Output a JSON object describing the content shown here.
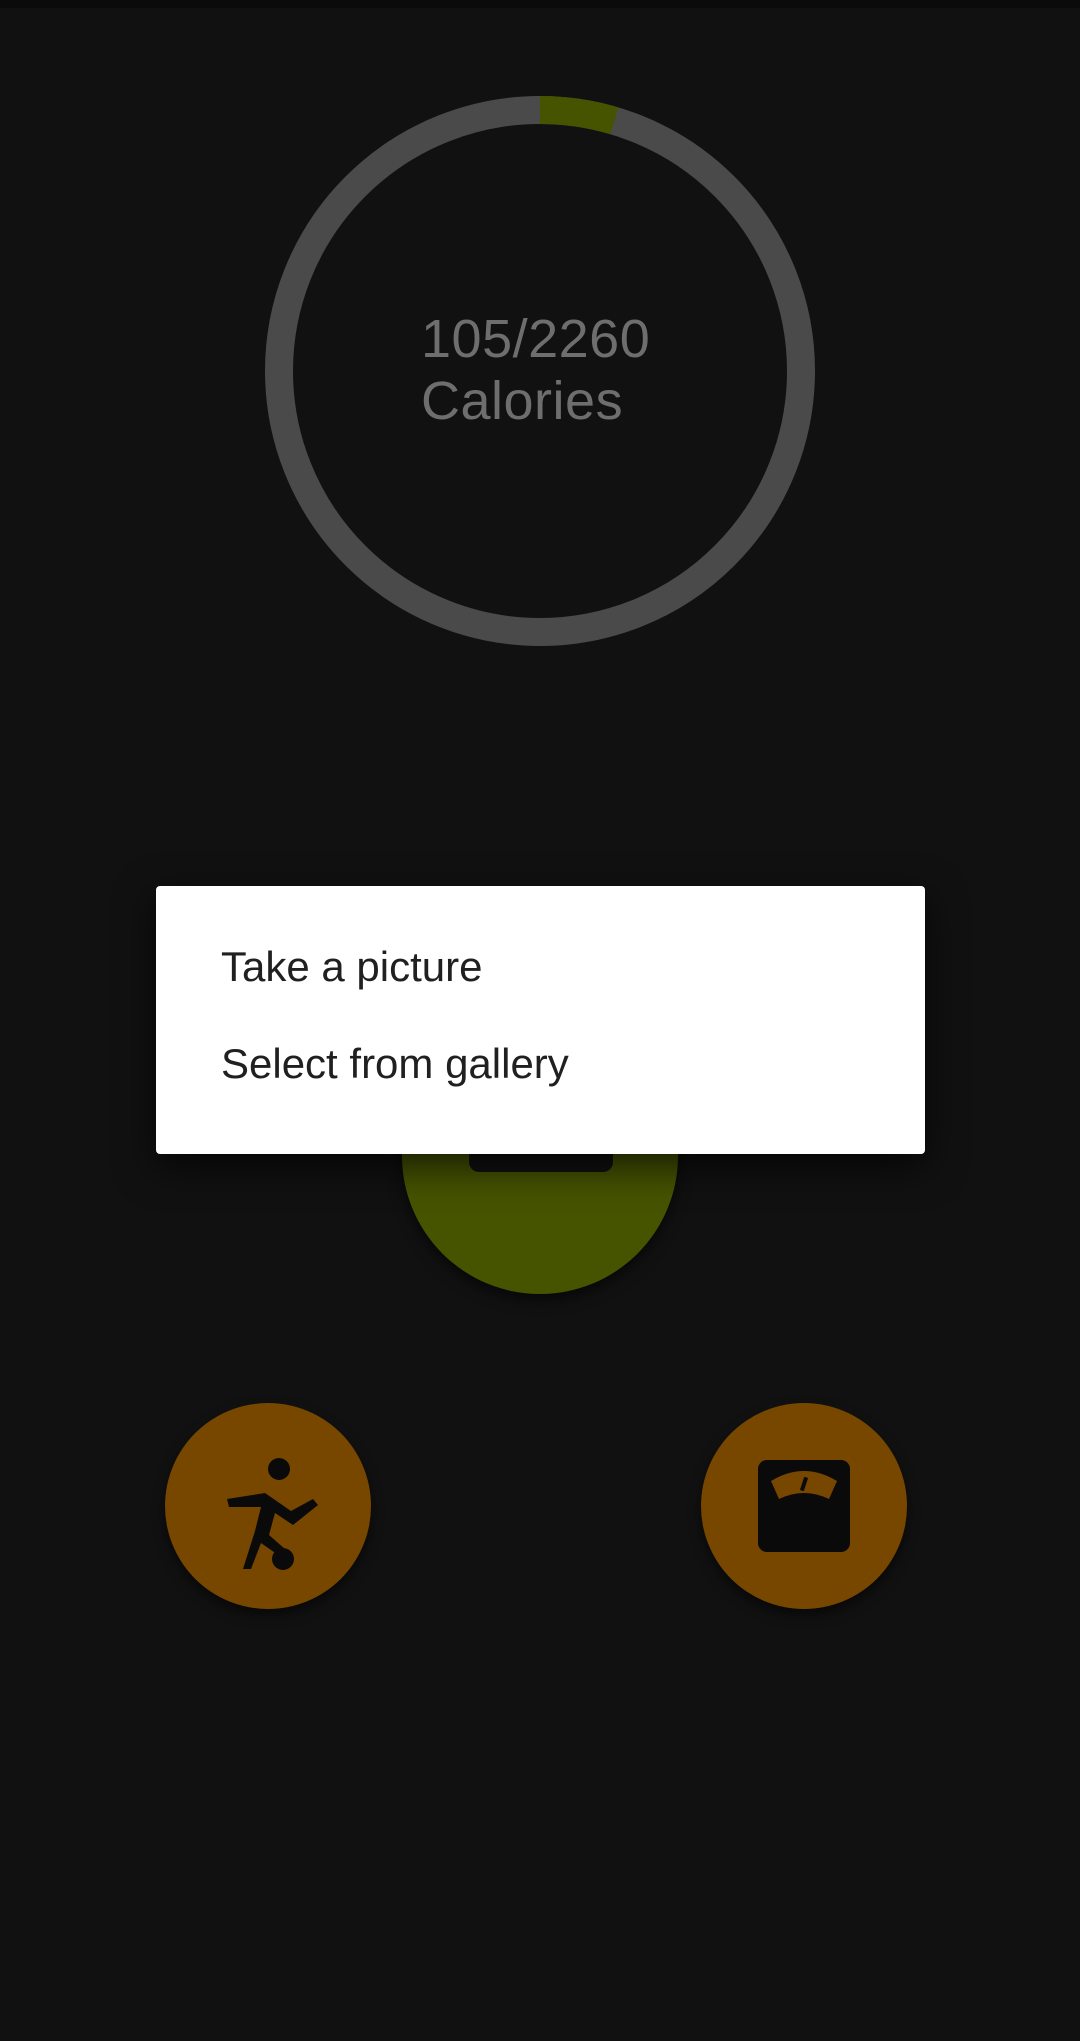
{
  "calories": {
    "consumed_over_goal": "105/2260",
    "unit_label": "Calories",
    "progress_fraction": 0.046
  },
  "colors": {
    "background": "#111111",
    "ring_track": "#4a4a4a",
    "ring_progress": "#465400",
    "camera_fab": "#465400",
    "secondary_fab": "#774700",
    "dialog_background": "#ffffff",
    "dialog_text": "#202020"
  },
  "actions": {
    "camera_icon": "camera-icon",
    "exercise_icon": "soccer-player-icon",
    "weight_icon": "scale-icon"
  },
  "dialog": {
    "options": [
      {
        "label": "Take a picture"
      },
      {
        "label": "Select from gallery"
      }
    ]
  }
}
